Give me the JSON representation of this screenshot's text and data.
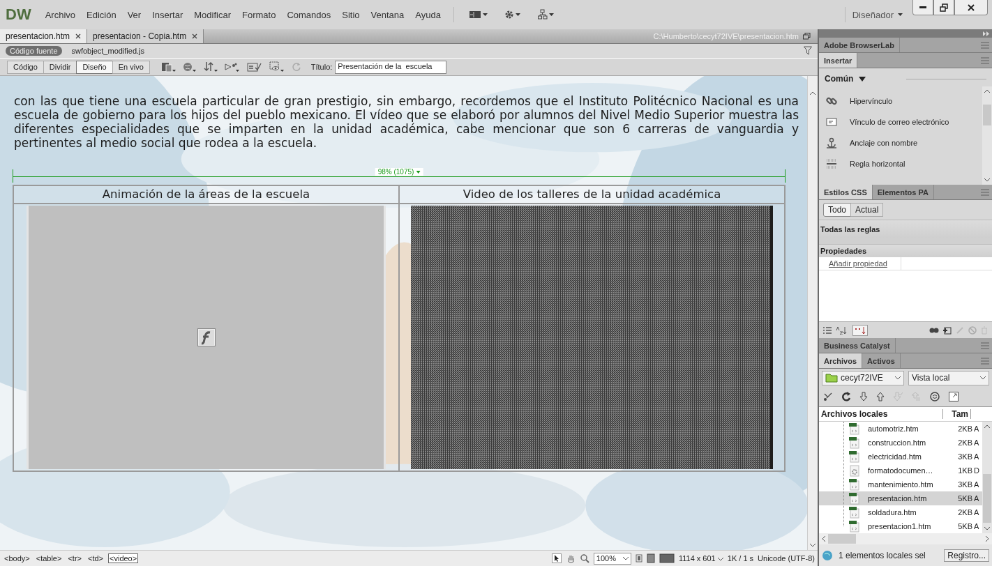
{
  "app": {
    "logo": "DW",
    "menu": [
      "Archivo",
      "Edición",
      "Ver",
      "Insertar",
      "Modificar",
      "Formato",
      "Comandos",
      "Sitio",
      "Ventana",
      "Ayuda"
    ],
    "workspace": "Diseñador"
  },
  "document_tabs": [
    {
      "label": "presentacion.htm",
      "selected": true
    },
    {
      "label": "presentacion - Copia.htm",
      "selected": false
    }
  ],
  "file_path": "C:\\Humberto\\cecyt72IVE\\presentacion.htm",
  "related_files": [
    {
      "label": "Código fuente",
      "selected": true
    },
    {
      "label": "swfobject_modified.js",
      "selected": false
    }
  ],
  "view_buttons": [
    {
      "label": "Código",
      "selected": false
    },
    {
      "label": "Dividir",
      "selected": false
    },
    {
      "label": "Diseño",
      "selected": true
    },
    {
      "label": "En vivo",
      "selected": false
    }
  ],
  "title_field": {
    "label": "Título:",
    "value": "Presentación de la  escuela"
  },
  "design": {
    "paragraph": "con las que tiene una escuela particular de gran prestigio, sin embargo, recordemos que el Instituto Politécnico Nacional es una escuela de gobierno para los hijos del pueblo mexicano. El vídeo que se elaboró por alumnos del Nivel Medio Superior muestra las diferentes especialidades que se imparten en la unidad académica, cabe mencionar que son 6 carreras de vanguardia y pertinentes al medio social que rodea a la escuela.",
    "table": {
      "width_label": "98% (1075)",
      "headers": [
        "Animación de la áreas de la escuela",
        "Video de los talleres de la unidad académica"
      ],
      "cells": [
        {
          "kind": "flash"
        },
        {
          "kind": "video"
        }
      ]
    }
  },
  "panels": {
    "browserlab": "Adobe BrowserLab",
    "insert": {
      "title": "Insertar",
      "category": "Común",
      "items": [
        {
          "label": "Hipervínculo",
          "kind": "link"
        },
        {
          "label": "Vínculo de correo electrónico",
          "kind": "email"
        },
        {
          "label": "Anclaje con nombre",
          "kind": "anchor"
        },
        {
          "label": "Regla horizontal",
          "kind": "rule"
        }
      ]
    },
    "css": {
      "tabs": [
        {
          "label": "Estilos CSS",
          "selected": true
        },
        {
          "label": "Elementos PA",
          "selected": false
        }
      ],
      "modes": [
        {
          "label": "Todo",
          "selected": true
        },
        {
          "label": "Actual",
          "selected": false
        }
      ],
      "rules_header": "Todas las reglas",
      "properties_header": "Propiedades",
      "add_property": "Añadir propiedad"
    },
    "business_catalyst": "Business Catalyst",
    "files": {
      "tabs": [
        {
          "label": "Archivos",
          "selected": true
        },
        {
          "label": "Activos",
          "selected": false
        }
      ],
      "site": "cecyt72IVE",
      "view": "Vista local",
      "columns": [
        "Archivos locales",
        "Tam"
      ],
      "rows": [
        {
          "name": "automotriz.htm",
          "size": "2KB",
          "column_3": "A",
          "kind": "html",
          "selected": false
        },
        {
          "name": "construccion.htm",
          "size": "2KB",
          "column_3": "A",
          "kind": "html",
          "selected": false
        },
        {
          "name": "electricidad.htm",
          "size": "3KB",
          "column_3": "A",
          "kind": "html",
          "selected": false
        },
        {
          "name": "formatodocumen…",
          "size": "1KB",
          "column_3": "D",
          "kind": "doc",
          "selected": false
        },
        {
          "name": "mantenimiento.htm",
          "size": "3KB",
          "column_3": "A",
          "kind": "html",
          "selected": false
        },
        {
          "name": "presentacion.htm",
          "size": "5KB",
          "column_3": "A",
          "kind": "html",
          "selected": true
        },
        {
          "name": "soldadura.htm",
          "size": "2KB",
          "column_3": "A",
          "kind": "html",
          "selected": false
        },
        {
          "name": "presentacion1.htm",
          "size": "5KB",
          "column_3": "A",
          "kind": "html",
          "selected": false
        }
      ],
      "status": "1 elementos locales sel",
      "log_button": "Registro..."
    }
  },
  "status_bar": {
    "tags": [
      {
        "label": "<body>",
        "selected": false
      },
      {
        "label": "<table>",
        "selected": false
      },
      {
        "label": "<tr>",
        "selected": false
      },
      {
        "label": "<td>",
        "selected": false
      },
      {
        "label": "<video>",
        "selected": true
      }
    ],
    "zoom": "100%",
    "window_size": "1114 x 601",
    "download": "1K / 1 s",
    "encoding": "Unicode (UTF-8)"
  }
}
